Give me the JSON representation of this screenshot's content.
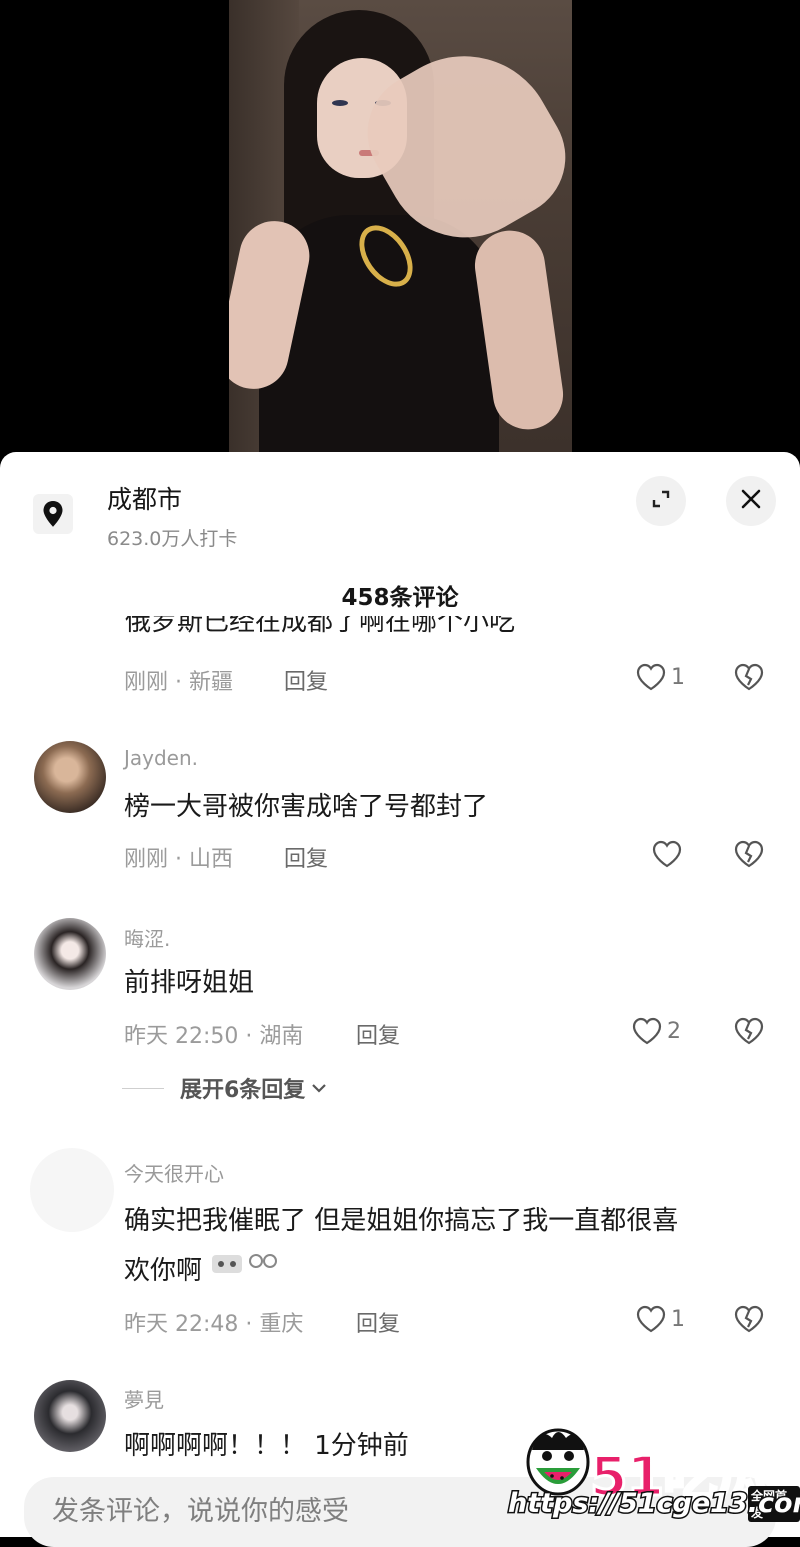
{
  "location": {
    "title": "成都市",
    "checkins": "623.0万人打卡"
  },
  "header": {
    "comment_count": "458条评论"
  },
  "comments": [
    {
      "text_partial": "俄罗斯已经在成都了啊在哪个小吃",
      "time": "刚刚 · 新疆",
      "reply": "回复",
      "likes": "1"
    },
    {
      "user": "Jayden.",
      "text": "榜一大哥被你害成啥了号都封了",
      "time": "刚刚 · 山西",
      "reply": "回复",
      "likes": ""
    },
    {
      "user": "晦涩.",
      "text": "前排呀姐姐",
      "time": "昨天 22:50 · 湖南",
      "reply": "回复",
      "likes": "2",
      "expand_replies": "展开6条回复"
    },
    {
      "user": "今天很开心",
      "text_line1": "确实把我催眠了 但是姐姐你搞忘了我一直都很喜",
      "text_line2": "欢你啊",
      "time": "昨天 22:48 · 重庆",
      "reply": "回复",
      "likes": "1"
    },
    {
      "user": "夢見",
      "text": "啊啊啊啊！！！ 1分钟前"
    }
  ],
  "input": {
    "placeholder": "发条评论，说说你的感受"
  },
  "watermark": {
    "logo": "51吃瓜",
    "badge": "全网首发",
    "url": "https://51cge13.com"
  },
  "icons": {
    "location": "location-pin-icon",
    "expand": "expand-icon",
    "close": "close-icon",
    "like": "heart-icon",
    "dislike": "broken-heart-icon"
  }
}
